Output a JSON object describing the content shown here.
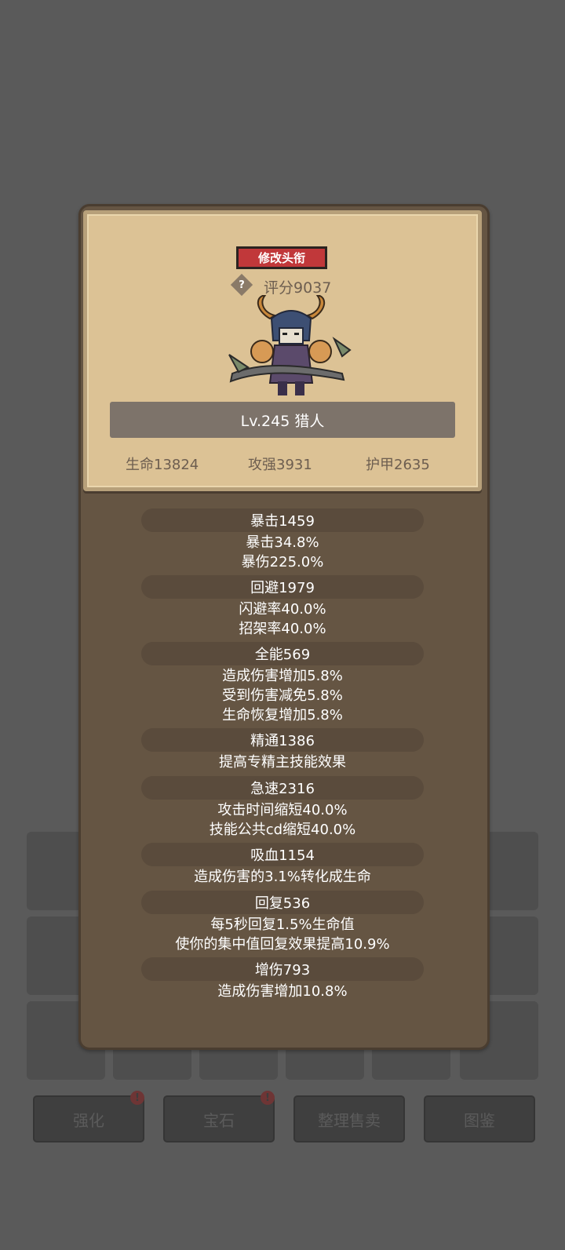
{
  "title_button": "修改头衔",
  "help_icon_glyph": "?",
  "score": "评分9037",
  "level": "Lv.245 猎人",
  "core_stats": [
    "生命13824",
    "攻强3931",
    "护甲2635"
  ],
  "stats": [
    {
      "header": "暴击1459",
      "lines": [
        "暴击34.8%",
        "暴伤225.0%"
      ]
    },
    {
      "header": "回避1979",
      "lines": [
        "闪避率40.0%",
        "招架率40.0%"
      ]
    },
    {
      "header": "全能569",
      "lines": [
        "造成伤害增加5.8%",
        "受到伤害减免5.8%",
        "生命恢复增加5.8%"
      ]
    },
    {
      "header": "精通1386",
      "lines": [
        "提高专精主技能效果"
      ]
    },
    {
      "header": "急速2316",
      "lines": [
        "攻击时间缩短40.0%",
        "技能公共cd缩短40.0%"
      ]
    },
    {
      "header": "吸血1154",
      "lines": [
        "造成伤害的3.1%转化成生命"
      ]
    },
    {
      "header": "回复536",
      "lines": [
        "每5秒回复1.5%生命值",
        "使你的集中值回复效果提高10.9%"
      ]
    },
    {
      "header": "增伤793",
      "lines": [
        "造成伤害增加10.8%"
      ]
    }
  ],
  "bottom_buttons": [
    {
      "label": "强化",
      "badge": "!"
    },
    {
      "label": "宝石",
      "badge": "!"
    },
    {
      "label": "整理售卖",
      "badge": ""
    },
    {
      "label": "图鉴",
      "badge": ""
    }
  ],
  "colors": {
    "title_button": "#c1383a",
    "panel": "#655543",
    "card": "#dcc295",
    "stat_header": "#5a4b3c"
  }
}
